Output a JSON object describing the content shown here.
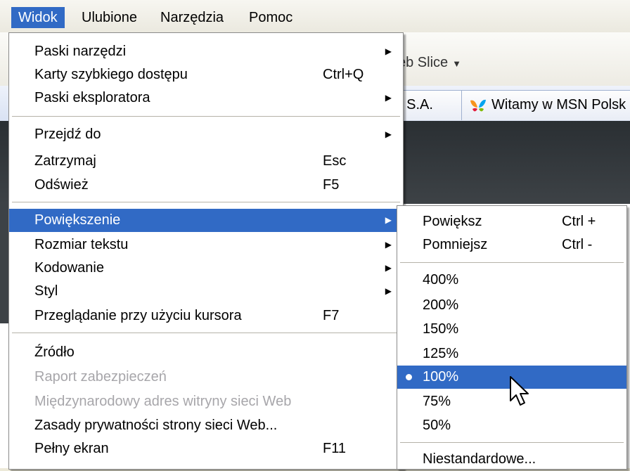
{
  "menubar": {
    "items": [
      {
        "label": "Widok",
        "active": true
      },
      {
        "label": "Ulubione",
        "active": false
      },
      {
        "label": "Narzędzia",
        "active": false
      },
      {
        "label": "Pomoc",
        "active": false
      }
    ]
  },
  "toolbar": {
    "web_slice_label": "eb Slice"
  },
  "tabs": [
    {
      "label": "t S.A."
    },
    {
      "label": "Witamy w MSN Polsk"
    }
  ],
  "view_menu": {
    "items": [
      {
        "label": "Paski narzędzi",
        "shortcut": "",
        "submenu": true
      },
      {
        "label": "Karty szybkiego dostępu",
        "shortcut": "Ctrl+Q",
        "submenu": false
      },
      {
        "label": "Paski eksploratora",
        "shortcut": "",
        "submenu": true
      },
      {
        "label": "Przejdź do",
        "shortcut": "",
        "submenu": true
      },
      {
        "label": "Zatrzymaj",
        "shortcut": "Esc",
        "submenu": false
      },
      {
        "label": "Odśwież",
        "shortcut": "F5",
        "submenu": false
      },
      {
        "label": "Powiększenie",
        "shortcut": "",
        "submenu": true,
        "highlighted": true
      },
      {
        "label": "Rozmiar tekstu",
        "shortcut": "",
        "submenu": true
      },
      {
        "label": "Kodowanie",
        "shortcut": "",
        "submenu": true
      },
      {
        "label": "Styl",
        "shortcut": "",
        "submenu": true
      },
      {
        "label": "Przeglądanie przy użyciu kursora",
        "shortcut": "F7",
        "submenu": false
      },
      {
        "label": "Źródło",
        "shortcut": "",
        "submenu": false
      },
      {
        "label": "Raport zabezpieczeń",
        "shortcut": "",
        "submenu": false,
        "disabled": true
      },
      {
        "label": "Międzynarodowy adres witryny sieci Web",
        "shortcut": "",
        "submenu": false,
        "disabled": true
      },
      {
        "label": "Zasady prywatności strony sieci Web...",
        "shortcut": "",
        "submenu": false
      },
      {
        "label": "Pełny ekran",
        "shortcut": "F11",
        "submenu": false
      }
    ]
  },
  "zoom_menu": {
    "items": [
      {
        "label": "Powiększ",
        "shortcut": "Ctrl +"
      },
      {
        "label": "Pomniejsz",
        "shortcut": "Ctrl -"
      },
      {
        "label": "400%",
        "shortcut": ""
      },
      {
        "label": "200%",
        "shortcut": ""
      },
      {
        "label": "150%",
        "shortcut": ""
      },
      {
        "label": "125%",
        "shortcut": ""
      },
      {
        "label": "100%",
        "shortcut": "",
        "selected": true
      },
      {
        "label": "75%",
        "shortcut": ""
      },
      {
        "label": "50%",
        "shortcut": ""
      },
      {
        "label": "Niestandardowe...",
        "shortcut": ""
      }
    ]
  },
  "colors": {
    "highlight": "#316ac5",
    "disabled_text": "#a7a6aa"
  },
  "icons": {
    "submenu_arrow": "submenu-arrow-icon",
    "bullet": "radio-bullet-icon",
    "msn": "msn-butterfly-icon",
    "cursor": "mouse-cursor-icon"
  }
}
